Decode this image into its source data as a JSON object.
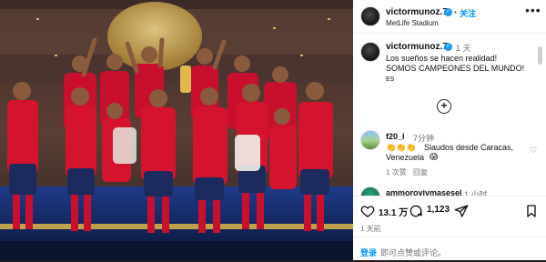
{
  "post": {
    "photo_alt": "Spain national team celebrating with the World Cup trophy",
    "header": {
      "username": "victormunoz.7",
      "follow_label": "关注",
      "location": "MetLife Stadium",
      "more_label": "•••"
    },
    "caption": {
      "username": "victormunoz.7",
      "time": "1 天",
      "line1": "Los sueños se hacen realidad!",
      "line2": "SOMOS CAMPEONES DEL MUNDO!",
      "flag_text": "ES",
      "add_label": "+"
    },
    "comments": [
      {
        "username": "f20_l",
        "time": "7分钟",
        "emojis": "👏👏👏",
        "text1": "Slaudos desde Caracas,",
        "text2": "Venezuela",
        "emoji2": "😱",
        "likes": "1 次赞",
        "reply": "回复"
      },
      {
        "username": "ammorovivmasesel",
        "time": "1 小时"
      }
    ],
    "actions": {
      "likes": "13.1 万",
      "comments": "1,123",
      "date": "1 天前"
    },
    "login": {
      "link": "登录",
      "text": "即可点赞或评论。"
    }
  }
}
